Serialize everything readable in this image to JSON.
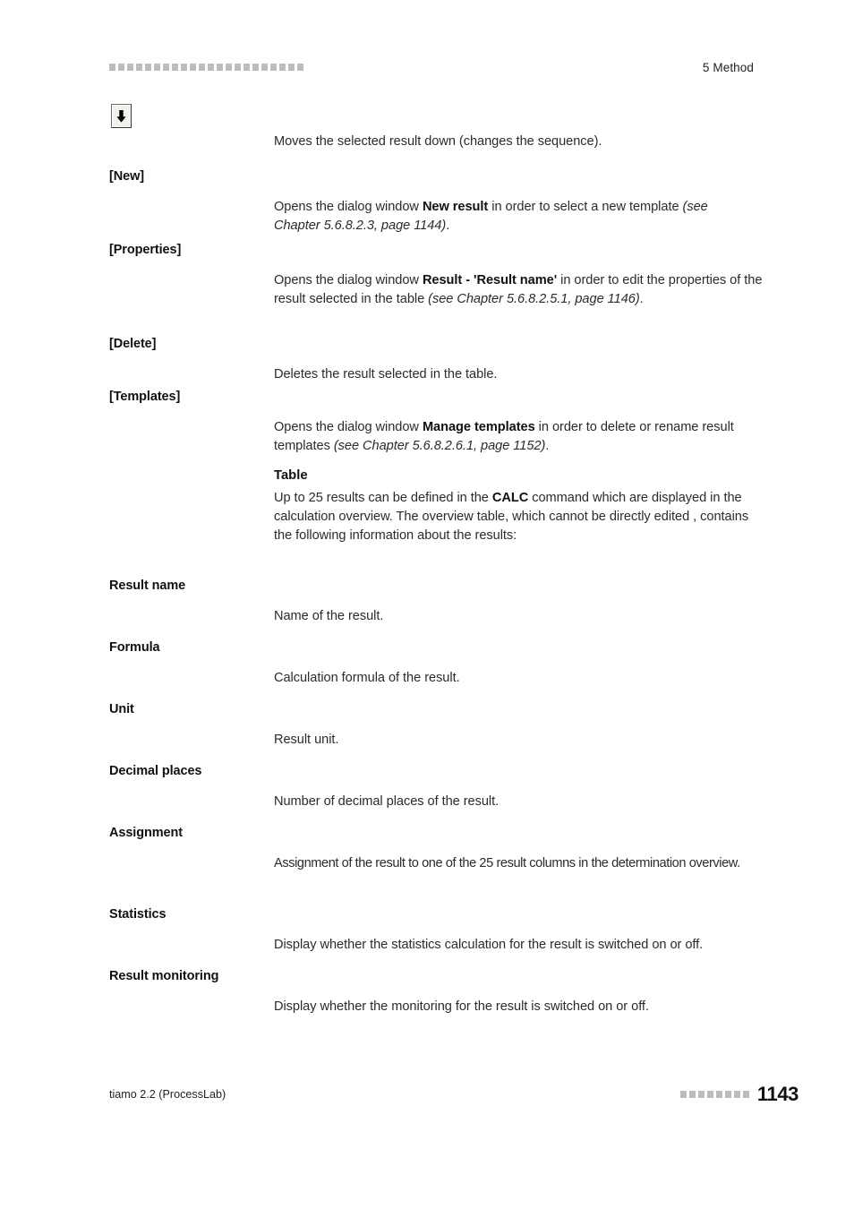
{
  "header": {
    "decoration_squares": 22,
    "title": "5 Method"
  },
  "icon": {
    "name": "move-down-button-icon",
    "glyph": "arrow-down"
  },
  "entries": [
    {
      "term": "",
      "desc_html": "Moves the selected result down (changes the sequence)."
    },
    {
      "term": "[New]",
      "desc_html": "Opens the dialog window <b>New result</b> in order to select a new template <i>(see Chapter 5.6.8.2.3, page 1144)</i>."
    },
    {
      "term": "[Properties]",
      "desc_html": "Opens the dialog window <b>Result - 'Result name'</b> in order to edit the properties of the result selected in the table <i>(see Chapter 5.6.8.2.5.1, page 1146)</i>."
    },
    {
      "term": "[Delete]",
      "desc_html": "Deletes the result selected in the table."
    },
    {
      "term": "[Templates]",
      "desc_html": "Opens the dialog window <b>Manage templates</b> in order to delete or rename result templates <i>(see Chapter 5.6.8.2.6.1, page 1152)</i>."
    },
    {
      "term": "",
      "sub_head": "Table",
      "desc_html": "Up to 25 results can be defined in the <b>CALC</b> command which are displayed in the calculation overview. The overview table, which cannot be directly edited , contains the following information about the results:"
    },
    {
      "term": "Result name",
      "desc_html": "Name of the result."
    },
    {
      "term": "Formula",
      "desc_html": "Calculation formula of the result."
    },
    {
      "term": "Unit",
      "desc_html": "Result unit."
    },
    {
      "term": "Decimal places",
      "desc_html": "Number of decimal places of the result."
    },
    {
      "term": "Assignment",
      "desc_html": "Assignment of the result to one of the 25 result columns in the determination overview."
    },
    {
      "term": "Statistics",
      "desc_html": "Display whether the statistics calculation for the result is switched on or off."
    },
    {
      "term": "Result monitoring",
      "desc_html": "Display whether the monitoring for the result is switched on or off."
    }
  ],
  "footer": {
    "product": "tiamo 2.2 (ProcessLab)",
    "decoration_squares": 8,
    "page_number": "1143"
  },
  "colors": {
    "text": "#231f20",
    "heading": "#111111",
    "decoration": "#bcbcbc",
    "page_background": "#ffffff"
  }
}
